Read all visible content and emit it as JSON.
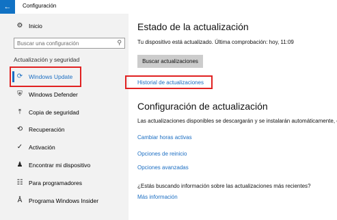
{
  "window": {
    "title": "Configuración",
    "back_icon": "arrow-left-icon"
  },
  "sidebar": {
    "home": {
      "icon": "gear-icon",
      "label": "Inicio"
    },
    "search_placeholder": "Buscar una configuración",
    "section_label": "Actualización y seguridad",
    "items": [
      {
        "label": "Windows Update",
        "icon": "refresh-icon",
        "selected": true
      },
      {
        "label": "Windows Defender",
        "icon": "shield-icon"
      },
      {
        "label": "Copia de seguridad",
        "icon": "backup-arrow-icon"
      },
      {
        "label": "Recuperación",
        "icon": "history-icon"
      },
      {
        "label": "Activación",
        "icon": "check-circle-icon"
      },
      {
        "label": "Encontrar mi dispositivo",
        "icon": "person-pin-icon"
      },
      {
        "label": "Para programadores",
        "icon": "tools-icon"
      },
      {
        "label": "Programa Windows Insider",
        "icon": "insider-icon"
      }
    ]
  },
  "main": {
    "status_title": "Estado de la actualización",
    "status_text": "Tu dispositivo está actualizado. Última comprobación: hoy, 11:09",
    "check_button": "Buscar actualizaciones",
    "history_link": "Historial de actualizaciones",
    "config_title": "Configuración de actualización",
    "config_text": "Las actualizaciones disponibles se descargarán y se instalarán automáticamente, ex",
    "links": [
      "Cambiar horas activas",
      "Opciones de reinicio",
      "Opciones avanzadas"
    ],
    "question": "¿Estás buscando información sobre las actualizaciones más recientes?",
    "more_info": "Más información"
  },
  "colors": {
    "accent": "#1a6dc2",
    "titlebar_back": "#1172c4",
    "highlight_box": "#e02020",
    "sidebar_bg": "#f2f2f2"
  }
}
